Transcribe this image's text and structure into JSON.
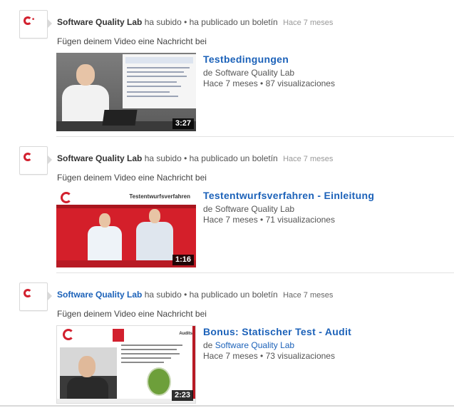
{
  "feed": [
    {
      "channel": "Software Quality Lab",
      "action": "ha subido • ha publicado un boletín",
      "time": "Hace 7 meses",
      "message": "Fügen deinem Video eine Nachricht bei",
      "video": {
        "title": "Testbedingungen",
        "by_prefix": "de",
        "uploader": "Software Quality Lab",
        "age": "Hace 7 meses",
        "views": "87 visualizaciones",
        "duration": "3:27"
      }
    },
    {
      "channel": "Software Quality Lab",
      "action": "ha subido • ha publicado un boletín",
      "time": "Hace 7 meses",
      "message": "Fügen deinem Video eine Nachricht bei",
      "video": {
        "title": "Testentwurfsverfahren - Einleitung",
        "by_prefix": "de",
        "uploader": "Software Quality Lab",
        "age": "Hace 7 meses",
        "views": "71 visualizaciones",
        "duration": "1:16"
      }
    },
    {
      "channel": "Software Quality Lab",
      "action": "ha subido • ha publicado un boletín",
      "time": "Hace 7 meses",
      "message": "Fügen deinem Video eine Nachricht bei",
      "video": {
        "title": "Bonus: Statischer Test - Audit",
        "by_prefix": "de",
        "uploader": "Software Quality Lab",
        "age": "Hace 7 meses",
        "views": "73 visualizaciones",
        "duration": "2:23"
      }
    }
  ],
  "thumbnail_text": {
    "slide2_title": "Testentwurfsverfahren",
    "slide3_label": "Audits"
  },
  "colors": {
    "link_blue": "#1c62b9",
    "brand_red": "#d2202e"
  },
  "separator": "•"
}
